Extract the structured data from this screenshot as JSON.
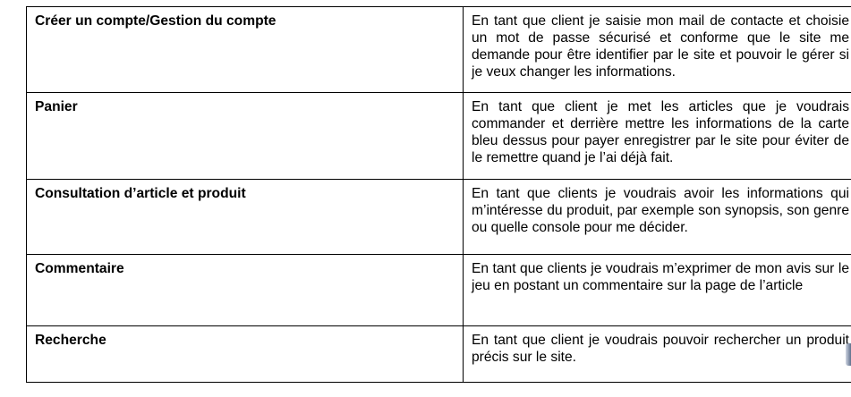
{
  "document": {
    "rows": [
      {
        "feature": "Créer un compte/Gestion du compte",
        "story": "En tant que client je saisie mon mail de contacte et choisie un mot de passe sécurisé et conforme que le site me demande pour être identifier par le site et pouvoir le gérer si je veux changer les informations."
      },
      {
        "feature": "Panier",
        "story": "En tant que client je met les articles que je voudrais commander et derrière mettre les informations de la carte bleu dessus pour payer enregistrer par le site pour éviter de le remettre quand je l’ai déjà fait."
      },
      {
        "feature": "Consultation d’article et produit",
        "story": "En tant que clients je voudrais avoir les informations qui m’intéresse du produit, par exemple son synopsis, son genre ou quelle console pour me décider."
      },
      {
        "feature": "Commentaire",
        "story": "En tant que clients je voudrais m’exprimer de mon avis sur le jeu en postant un commentaire sur la page de l’article"
      },
      {
        "feature": "Recherche",
        "story": "En tant que client je voudrais pouvoir rechercher un produit précis sur le site."
      }
    ]
  }
}
